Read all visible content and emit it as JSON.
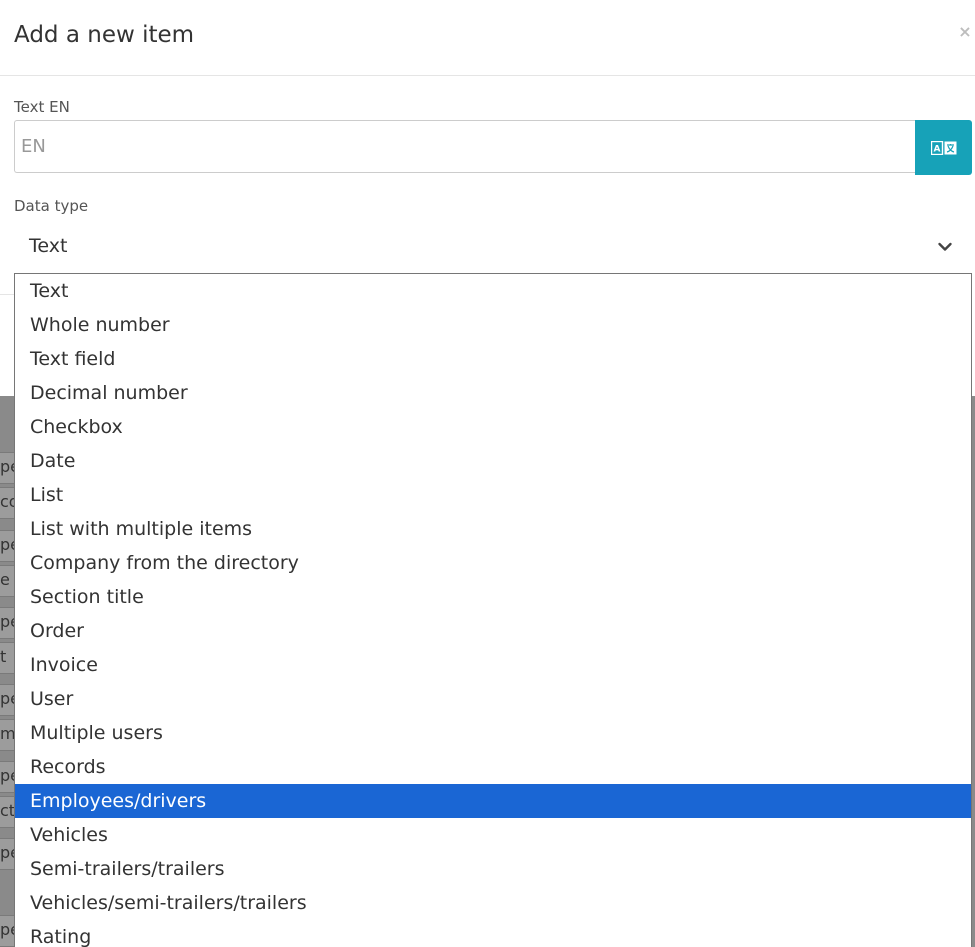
{
  "modal": {
    "title": "Add a new item",
    "close_label": "×"
  },
  "text_field": {
    "label": "Text EN",
    "placeholder": "EN",
    "value": ""
  },
  "data_type": {
    "label": "Data type",
    "selected": "Text"
  },
  "dropdown": {
    "options": [
      "Text",
      "Whole number",
      "Text field",
      "Decimal number",
      "Checkbox",
      "Date",
      "List",
      "List with multiple items",
      "Company from the directory",
      "Section title",
      "Order",
      "Invoice",
      "User",
      "Multiple users",
      "Records",
      "Employees/drivers",
      "Vehicles",
      "Semi-trailers/trailers",
      "Vehicles/semi-trailers/trailers",
      "Rating"
    ],
    "highlighted_index": 15
  },
  "background": {
    "fragments": [
      "pe",
      "co",
      "pe",
      "e",
      "pe",
      "t",
      "pe",
      "mp",
      "pe",
      "cti",
      "pe",
      "pe"
    ]
  },
  "colors": {
    "accent": "#17a2b8",
    "highlight": "#1a66d4"
  },
  "icons": {
    "translate": "translate-icon",
    "chevron": "chevron-down-icon",
    "close": "close-icon"
  }
}
